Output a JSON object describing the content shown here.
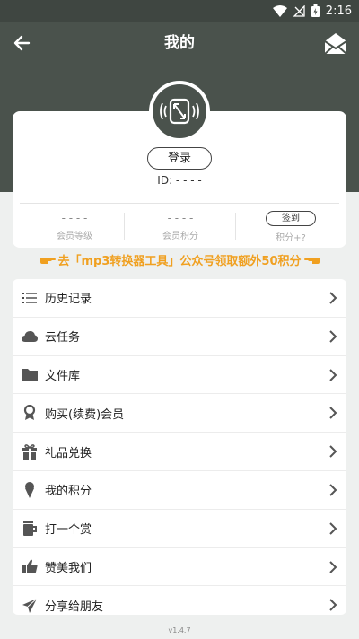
{
  "status_bar": {
    "time": "2:16"
  },
  "app_bar": {
    "title": "我的"
  },
  "profile": {
    "login_label": "登录",
    "id_text": "ID: - - - -",
    "stats": [
      {
        "value": "- - - -",
        "label": "会员等级"
      },
      {
        "value": "- - - -",
        "label": "会员积分"
      }
    ],
    "sign_in_label": "签到",
    "sign_in_caption": "积分+?"
  },
  "promo_text": "去「mp3转换器工具」公众号领取额外50积分",
  "menu": [
    {
      "label": "历史记录",
      "icon": "list-icon"
    },
    {
      "label": "云任务",
      "icon": "cloud-icon"
    },
    {
      "label": "文件库",
      "icon": "folder-icon"
    },
    {
      "label": "购买(续费)会员",
      "icon": "award-icon"
    },
    {
      "label": "礼品兑换",
      "icon": "gift-icon"
    },
    {
      "label": "我的积分",
      "icon": "ice-cream-icon"
    },
    {
      "label": "打一个赏",
      "icon": "mug-icon"
    },
    {
      "label": "赞美我们",
      "icon": "thumbs-up-icon"
    },
    {
      "label": "分享给朋友",
      "icon": "paper-plane-icon"
    }
  ],
  "version": "v1.4.7",
  "colors": {
    "header": "#4a524c",
    "promo": "#f0a020",
    "background": "#eef0ef"
  }
}
